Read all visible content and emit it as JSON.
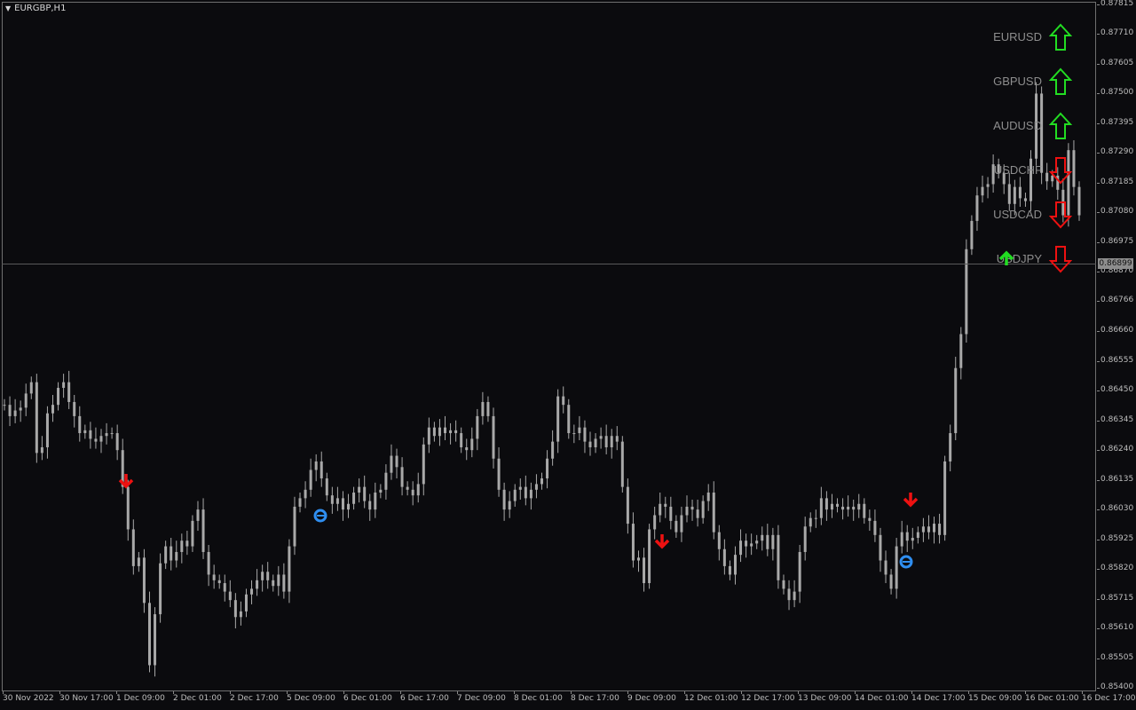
{
  "window": {
    "title": "EURGBP,H1"
  },
  "price_axis": {
    "ticks": [
      "0.87815",
      "0.87710",
      "0.87605",
      "0.87500",
      "0.87395",
      "0.87290",
      "0.87185",
      "0.87080",
      "0.86975",
      "0.86870",
      "0.86766",
      "0.86660",
      "0.86555",
      "0.86450",
      "0.86345",
      "0.86240",
      "0.86135",
      "0.86030",
      "0.85925",
      "0.85820",
      "0.85715",
      "0.85610",
      "0.85505",
      "0.85400"
    ],
    "current_price": "0.86899"
  },
  "time_axis": {
    "ticks": [
      "30 Nov 2022",
      "30 Nov 17:00",
      "1 Dec 09:00",
      "2 Dec 01:00",
      "2 Dec 17:00",
      "5 Dec 09:00",
      "6 Dec 01:00",
      "6 Dec 17:00",
      "7 Dec 09:00",
      "8 Dec 01:00",
      "8 Dec 17:00",
      "9 Dec 09:00",
      "12 Dec 01:00",
      "12 Dec 17:00",
      "13 Dec 09:00",
      "14 Dec 01:00",
      "14 Dec 17:00",
      "15 Dec 09:00",
      "16 Dec 01:00",
      "16 Dec 17:00"
    ]
  },
  "dashboard": {
    "rows": [
      {
        "symbol": "EURUSD",
        "direction": "up"
      },
      {
        "symbol": "GBPUSD",
        "direction": "up"
      },
      {
        "symbol": "AUDUSD",
        "direction": "up"
      },
      {
        "symbol": "USDCHF",
        "direction": "down"
      },
      {
        "symbol": "USDCAD",
        "direction": "down"
      },
      {
        "symbol": "USDJPY",
        "direction": "down"
      }
    ]
  },
  "colors": {
    "background": "#0b0b0e",
    "candle": "#a9a9a9",
    "up_arrow": "#22dd22",
    "down_arrow": "#ee1111",
    "signal_circle": "#2f8ef0"
  },
  "chart_data": {
    "type": "candlestick",
    "symbol": "EURGBP",
    "timeframe": "H1",
    "ylim": [
      0.854,
      0.87815
    ],
    "current_price": 0.86899,
    "closes": [
      0.864,
      0.8636,
      0.8638,
      0.8639,
      0.8644,
      0.8648,
      0.8623,
      0.8625,
      0.8637,
      0.864,
      0.8646,
      0.8648,
      0.8641,
      0.8636,
      0.863,
      0.8631,
      0.8628,
      0.8627,
      0.8629,
      0.863,
      0.863,
      0.8624,
      0.8611,
      0.8596,
      0.8583,
      0.8586,
      0.857,
      0.8548,
      0.8566,
      0.8584,
      0.859,
      0.8585,
      0.8588,
      0.8592,
      0.859,
      0.8599,
      0.8603,
      0.8588,
      0.858,
      0.8578,
      0.8577,
      0.8574,
      0.8571,
      0.8565,
      0.8567,
      0.8573,
      0.8575,
      0.8578,
      0.8581,
      0.8578,
      0.8576,
      0.858,
      0.8574,
      0.859,
      0.8604,
      0.8607,
      0.861,
      0.8617,
      0.862,
      0.8614,
      0.8608,
      0.8605,
      0.8607,
      0.8603,
      0.8605,
      0.8609,
      0.8611,
      0.8606,
      0.8603,
      0.8609,
      0.861,
      0.8616,
      0.8622,
      0.8618,
      0.8611,
      0.861,
      0.8608,
      0.8612,
      0.8626,
      0.8632,
      0.8629,
      0.8632,
      0.863,
      0.8631,
      0.863,
      0.8625,
      0.8624,
      0.8628,
      0.8636,
      0.8641,
      0.8636,
      0.8621,
      0.861,
      0.8603,
      0.8606,
      0.861,
      0.8611,
      0.8607,
      0.861,
      0.8612,
      0.8614,
      0.8621,
      0.8627,
      0.8643,
      0.864,
      0.863,
      0.863,
      0.8632,
      0.8627,
      0.8625,
      0.8628,
      0.8629,
      0.8625,
      0.8629,
      0.8627,
      0.8611,
      0.8598,
      0.8585,
      0.8586,
      0.8577,
      0.8596,
      0.8601,
      0.8605,
      0.8604,
      0.8599,
      0.8595,
      0.8601,
      0.8604,
      0.8603,
      0.86,
      0.8606,
      0.8609,
      0.8595,
      0.8589,
      0.8583,
      0.858,
      0.8587,
      0.8592,
      0.859,
      0.8591,
      0.8592,
      0.8594,
      0.8589,
      0.8594,
      0.8578,
      0.8575,
      0.8571,
      0.8574,
      0.8588,
      0.8597,
      0.86,
      0.86,
      0.8607,
      0.8603,
      0.8605,
      0.8604,
      0.8603,
      0.8604,
      0.8603,
      0.8605,
      0.86,
      0.8599,
      0.8594,
      0.8585,
      0.858,
      0.8575,
      0.859,
      0.8595,
      0.8592,
      0.8593,
      0.8595,
      0.8597,
      0.8595,
      0.8598,
      0.8594,
      0.862,
      0.863,
      0.8653,
      0.8665,
      0.8695,
      0.8705,
      0.8714,
      0.8717,
      0.8718,
      0.8725,
      0.8722,
      0.8718,
      0.8711,
      0.8717,
      0.8713,
      0.8712,
      0.8727,
      0.875,
      0.8722,
      0.8719,
      0.8721,
      0.8716,
      0.8707,
      0.873,
      0.8717,
      0.8707
    ]
  }
}
